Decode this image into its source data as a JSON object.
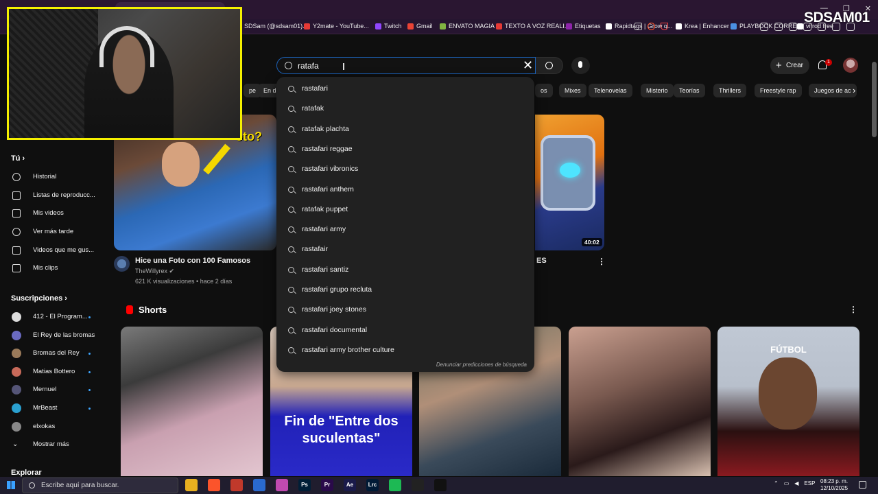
{
  "browser": {
    "bookmarks": [
      {
        "label": "SDSam (@sdsam01)...",
        "color": "#555555"
      },
      {
        "label": "Y2mate - YouTube...",
        "color": "#e53935"
      },
      {
        "label": "Twitch",
        "color": "#9146ff"
      },
      {
        "label": "Gmail",
        "color": "#ea4335"
      },
      {
        "label": "ENVATO MAGIA",
        "color": "#81b441"
      },
      {
        "label": "TEXTO A VOZ REALI...",
        "color": "#e53935"
      },
      {
        "label": "Etiquetas",
        "color": "#8e24aa"
      },
      {
        "label": "Rapidtags | Grow q...",
        "color": "#ffffff"
      },
      {
        "label": "Krea | Enhancer",
        "color": "#ffffff"
      },
      {
        "label": "PLAYBOOK CORREO",
        "color": "#4a90e2"
      },
      {
        "label": "vifrod free",
        "color": "#ffffff"
      }
    ],
    "overlay_brand": "SDSAM01"
  },
  "header": {
    "search_query": "ratafa",
    "create_label": "Crear",
    "notification_count": "1"
  },
  "search_suggestions": [
    "rastafari",
    "ratafak",
    "ratafak plachta",
    "rastafari reggae",
    "rastafari vibronics",
    "rastafari anthem",
    "ratafak puppet",
    "rastafari army",
    "rastafair",
    "rastafari santiz",
    "rastafari grupo recluta",
    "rastafari joey stones",
    "rastafari documental",
    "rastafari army brother culture"
  ],
  "report_predictions": "Denunciar predicciones de búsqueda",
  "chips": [
    "pe",
    "En di",
    "os",
    "Mixes",
    "Telenovelas",
    "Misterio",
    "Teorías",
    "Thrillers",
    "Freestyle rap",
    "Juegos de ac"
  ],
  "sidebar": {
    "you_heading": "Tú",
    "you_items": [
      {
        "label": "Historial",
        "icon": "history-icon"
      },
      {
        "label": "Listas de reproducc...",
        "icon": "playlist-icon"
      },
      {
        "label": "Mis videos",
        "icon": "my-videos-icon"
      },
      {
        "label": "Ver más tarde",
        "icon": "watch-later-icon"
      },
      {
        "label": "Videos que me gus...",
        "icon": "like-icon"
      },
      {
        "label": "Mis clips",
        "icon": "clips-icon"
      }
    ],
    "subs_heading": "Suscripciones",
    "subscriptions": [
      {
        "label": "412 - El Program...",
        "color": "#dddddd",
        "new": true
      },
      {
        "label": "El Rey de las bromas",
        "color": "#6a6ac0",
        "new": false
      },
      {
        "label": "Bromas del Rey",
        "color": "#9a7a5a",
        "new": true
      },
      {
        "label": "Matias Bottero",
        "color": "#c86a5a",
        "new": true
      },
      {
        "label": "Mernuel",
        "color": "#555577",
        "new": true
      },
      {
        "label": "MrBeast",
        "color": "#2aa0d0",
        "new": true
      },
      {
        "label": "elxokas",
        "color": "#888888",
        "new": false
      }
    ],
    "show_more": "Mostrar más",
    "explore_heading": "Explorar"
  },
  "videos": [
    {
      "title": "Hice una Foto con 100 Famosos",
      "channel": "TheWillyrex",
      "meta": "621 K visualizaciones • hace 2 días",
      "overlay_text": "oto?"
    },
    {
      "title_tail": "ES",
      "duration": "40:02"
    }
  ],
  "shorts": {
    "heading": "Shorts",
    "items": [
      {
        "caption": ""
      },
      {
        "caption": "Fin de \"Entre dos suculentas\""
      },
      {
        "caption": ""
      },
      {
        "caption": ""
      },
      {
        "caption": "FÚTBOL"
      }
    ]
  },
  "taskbar": {
    "search_placeholder": "Escribe aquí para buscar.",
    "apps": [
      {
        "label": "",
        "color": "#e8b020"
      },
      {
        "label": "",
        "color": "#fb542b"
      },
      {
        "label": "",
        "color": "#c0392b"
      },
      {
        "label": "",
        "color": "#2a6acf"
      },
      {
        "label": "",
        "color": "#c04ab0"
      },
      {
        "label": "Ps",
        "color": "#001e36"
      },
      {
        "label": "Pr",
        "color": "#2a0a4a"
      },
      {
        "label": "Ae",
        "color": "#1a1a4a"
      },
      {
        "label": "Lrc",
        "color": "#001a36"
      },
      {
        "label": "",
        "color": "#1db954"
      },
      {
        "label": "",
        "color": "#222222"
      },
      {
        "label": "",
        "color": "#111111"
      }
    ],
    "language": "ESP",
    "time": "08:23 p. m.",
    "date": "12/10/2025"
  }
}
